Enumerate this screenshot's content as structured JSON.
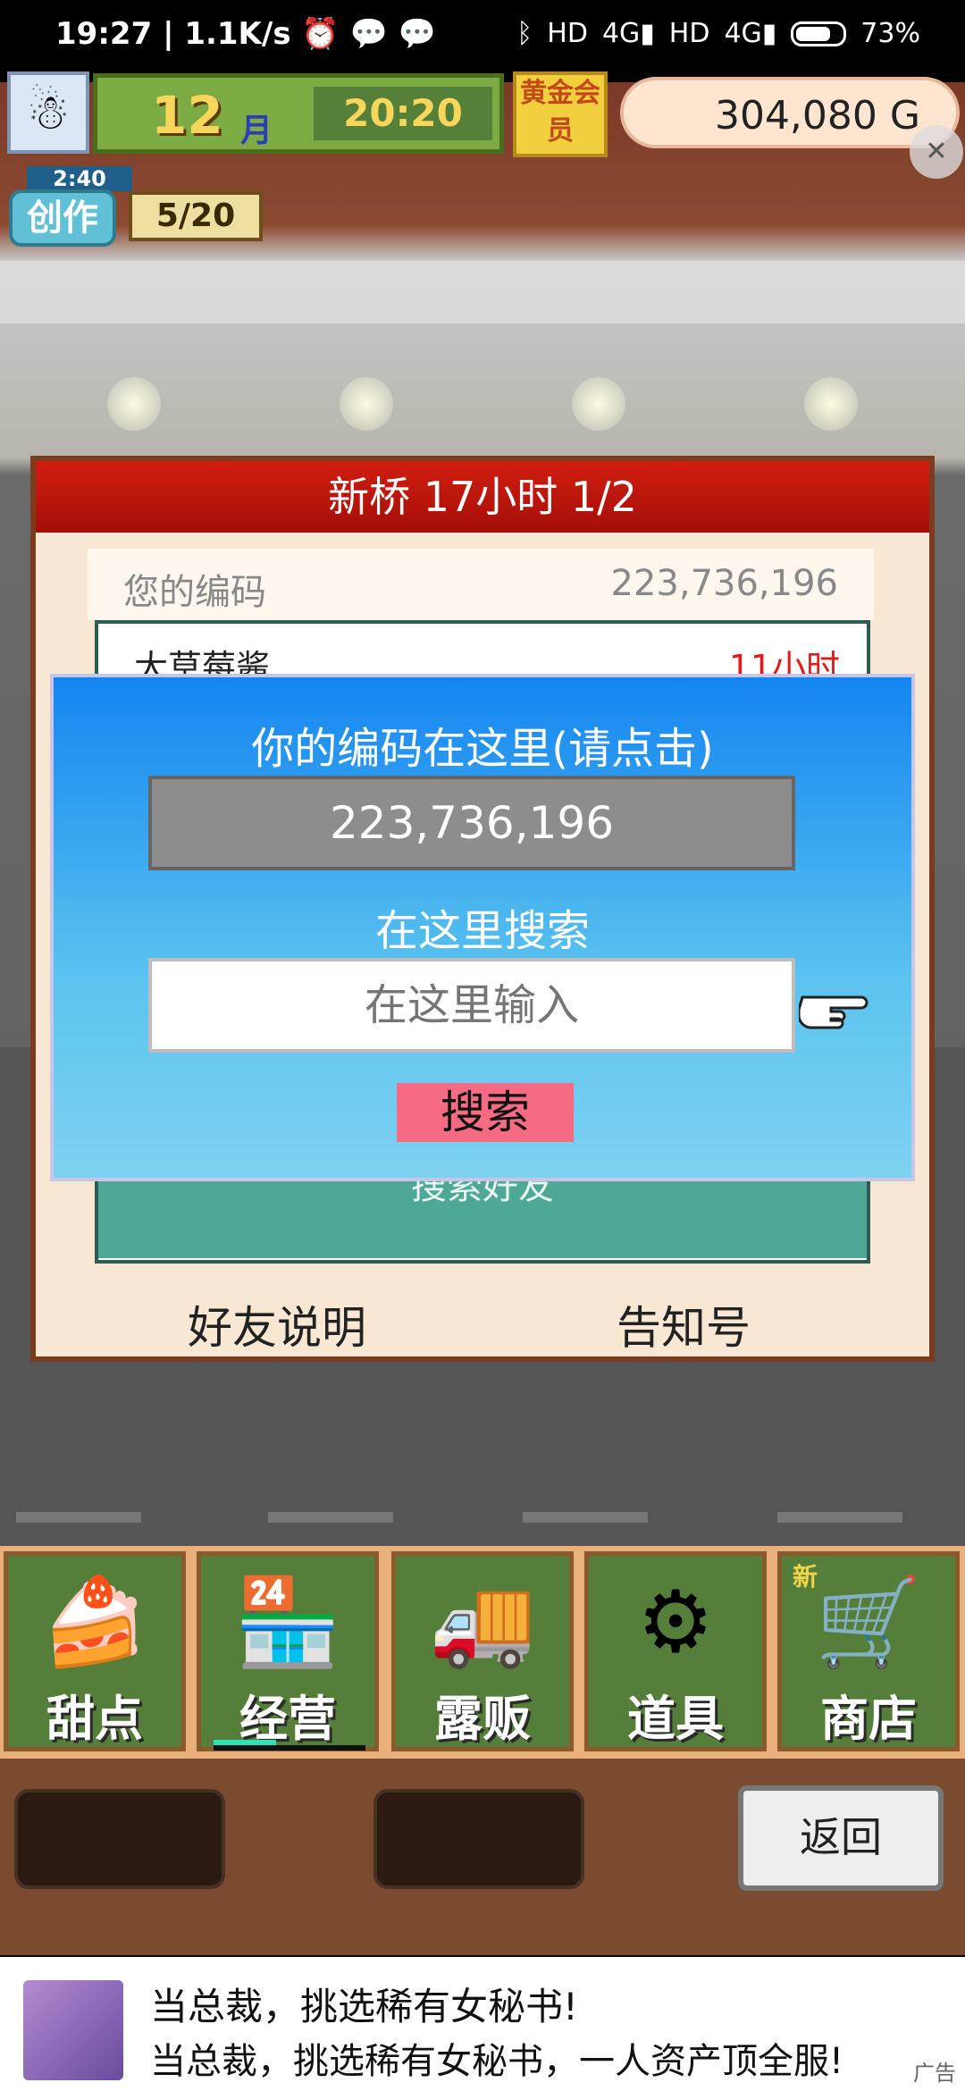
{
  "status_bar": {
    "time": "19:27",
    "speed": "1.1K/s",
    "icons": [
      "alarm-icon",
      "wechat-icon",
      "wechat-icon",
      "bluetooth-icon",
      "hd-icon",
      "signal-4g-icon",
      "hd-icon",
      "signal-4g-icon",
      "battery-icon"
    ],
    "battery": "73"
  },
  "hud": {
    "month_value": "12",
    "month_unit": "月",
    "clock": "20:20",
    "gold_member": "黄金会员",
    "money": "304,080 G",
    "create_timer": "2:40",
    "create_label": "创作",
    "create_progress": "5/20"
  },
  "panel": {
    "title": "新桥  17小时 1/2",
    "your_code_label": "您的编码",
    "your_code_value": "223,736,196",
    "friend_row_name": "大草莓酱",
    "friend_row_time": "11小时",
    "search_friends": "搜索好友",
    "footer_left": "好友说明",
    "footer_right": "告知号"
  },
  "dialog": {
    "heading": "你的编码在这里(请点击)",
    "code_value": "223,736,196",
    "search_heading": "在这里搜索",
    "search_placeholder": "在这里输入",
    "search_button": "搜索"
  },
  "bottom_nav": {
    "items": [
      {
        "label": "甜点",
        "icon": "cake-icon"
      },
      {
        "label": "经营",
        "icon": "shop-icon"
      },
      {
        "label": "露贩",
        "icon": "food-truck-icon"
      },
      {
        "label": "道具",
        "icon": "gear-bag-icon"
      },
      {
        "label": "商店",
        "icon": "cart-icon",
        "badge": "新"
      }
    ]
  },
  "action_bar": {
    "back": "返回"
  },
  "ad": {
    "line1": "当总裁，挑选稀有女秘书!",
    "line2": "当总裁，挑选稀有女秘书，一人资产顶全服!",
    "tag": "广告"
  }
}
